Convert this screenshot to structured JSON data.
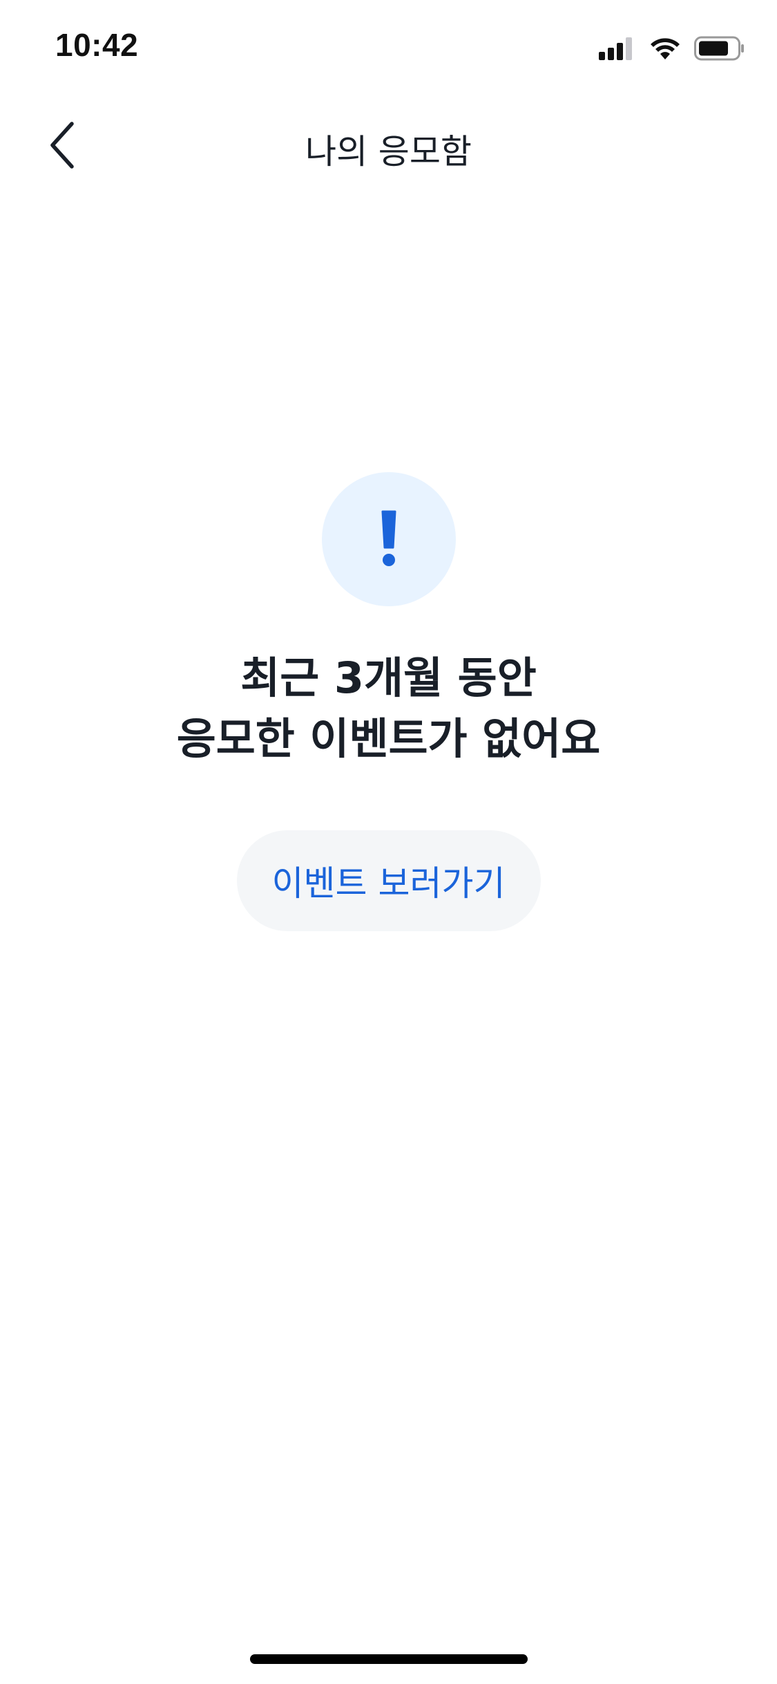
{
  "status_bar": {
    "time": "10:42",
    "icons": [
      "cellular-signal-icon",
      "wifi-icon",
      "battery-icon"
    ]
  },
  "header": {
    "back_icon": "chevron-left-icon",
    "title": "나의 응모함"
  },
  "empty_state": {
    "icon": "exclamation-icon",
    "message_line1": "최근 3개월 동안",
    "message_line2": "응모한 이벤트가 없어요",
    "button_label": "이벤트 보러가기"
  },
  "colors": {
    "accent": "#1b64da",
    "icon_bg": "#e8f3ff",
    "button_bg": "#f4f6f8",
    "text": "#191f28"
  }
}
